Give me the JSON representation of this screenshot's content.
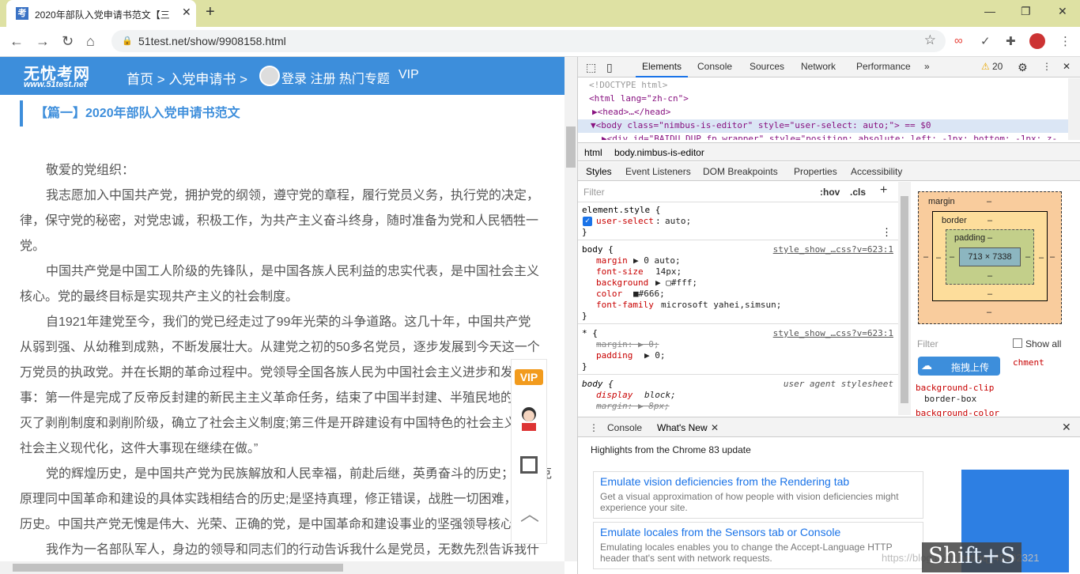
{
  "browser": {
    "tab_title": "2020年部队入党申请书范文【三",
    "tab_favicon": "考",
    "url": "51test.net/show/9908158.html"
  },
  "site": {
    "logo_main": "无忧考网",
    "logo_sub": "www.51test.net",
    "breadcrumb": "首页 > 入党申请书 >",
    "userbar": "登录 注册 热门专题",
    "vip": "VIP",
    "article_title": "【篇一】2020年部队入党申请书范文",
    "paragraphs": [
      "敬爱的党组织：",
      "我志愿加入中国共产党，拥护党的纲领，遵守党的章程，履行党员义务，执行党的决定，",
      "律，保守党的秘密，对党忠诚，积极工作，为共产主义奋斗终身，随时准备为党和人民牺牲一",
      "党。",
      "中国共产党是中国工人阶级的先锋队，是中国各族人民利益的忠实代表，是中国社会主义",
      "核心。党的最终目标是实现共产主义的社会制度。",
      "自1921年建党至今，我们的党已经走过了99年光荣的斗争道路。这几十年，中国共产党",
      "从弱到强、从幼稚到成熟，不断发展壮大。从建党之初的50多名党员，逐步发展到今天这一个",
      "万党员的执政党。并在长期的革命过程中。党领导全国各族人民为中国社会主义进步和发展做",
      "事：第一件是完成了反帝反封建的新民主主义革命任务，结束了中国半封建、半殖民地的历史",
      "灭了剥削制度和剥削阶级，确立了社会主义制度;第三件是开辟建设有中国特色的社会主义道路",
      "社会主义现代化，这件大事现在继续在做。”",
      "党的辉煌历史，是中国共产党为民族解放和人民幸福，前赴后继，英勇奋斗的历史；是马克",
      "原理同中国革命和建设的具体实践相结合的历史;是坚持真理，修正错误，战胜一切困难，不断",
      "历史。中国共产党无愧是伟大、光荣、正确的党，是中国革命和建设事业的坚强领导核心。",
      "我作为一名部队军人，身边的领导和同志们的行动告诉我什么是党员，无数先烈告诉我什"
    ],
    "float_vip": "VIP"
  },
  "devtools": {
    "tabs": [
      "Elements",
      "Console",
      "Sources",
      "Network",
      "Performance",
      "»"
    ],
    "warnings": "20",
    "dom_lines": [
      "<!DOCTYPE html>",
      "<html lang=\"zh-cn\">",
      "▶<head>…</head>",
      "▼<body class=\"nimbus-is-editor\" style=\"user-select: auto;\"> == $0",
      "▶<div id=\"BAIDU_DUP_fp_wrapper\" style=\"position: absolute; left: -1px; bottom: -1px; z-"
    ],
    "crumb_html": "html",
    "crumb_body": "body.nimbus-is-editor",
    "subtabs": [
      "Styles",
      "Event Listeners",
      "DOM Breakpoints",
      "Properties",
      "Accessibility"
    ],
    "filter_placeholder": "Filter",
    "hov": ":hov",
    "cls": ".cls",
    "styles": {
      "element_selector": "element.style {",
      "element_prop": "user-select",
      "element_val": "auto;",
      "body_selector": "body {",
      "body_src": "style_show_…css?v=623:1",
      "body_props": [
        {
          "p": "margin",
          "v": "▶ 0 auto;"
        },
        {
          "p": "font-size",
          "v": "14px;"
        },
        {
          "p": "background",
          "v": "▶ ▢#fff;"
        },
        {
          "p": "color",
          "v": "■#666;"
        },
        {
          "p": "font-family",
          "v": "microsoft yahei,simsun;"
        }
      ],
      "star_selector": "* {",
      "star_src": "style_show_…css?v=623:1",
      "star_margin": "margin: ▶ 0;",
      "star_padding_p": "padding",
      "star_padding_v": "▶ 0;",
      "ua_selector": "body {",
      "ua_src": "user agent stylesheet",
      "ua_display_p": "display",
      "ua_display_v": "block;",
      "ua_margin": "margin: ▶ 8px;",
      "close": "}"
    },
    "boxmodel": {
      "margin": "margin",
      "border": "border",
      "padding": "padding",
      "content": "713 × 7338",
      "dash": "–"
    },
    "computed": {
      "filter": "Filter",
      "show_all": "Show all",
      "attach": "chment",
      "prop1": "background-clip",
      "val1": "border-box",
      "prop2": "background-color"
    },
    "drawer_tabs": [
      "Console",
      "What's New"
    ],
    "whats_new_header": "Highlights from the Chrome 83 update",
    "cards": [
      {
        "title": "Emulate vision deficiencies from the Rendering tab",
        "desc": "Get a visual approximation of how people with vision deficiencies might experience your site."
      },
      {
        "title": "Emulate locales from the Sensors tab or Console",
        "desc": "Emulating locales enables you to change the Accept-Language HTTP header that's sent with network requests."
      }
    ]
  },
  "overlays": {
    "upload": "拖拽上传",
    "watermark": "https://blog.csdn.net/qq_45392321",
    "shift_s": "Shift+S"
  }
}
